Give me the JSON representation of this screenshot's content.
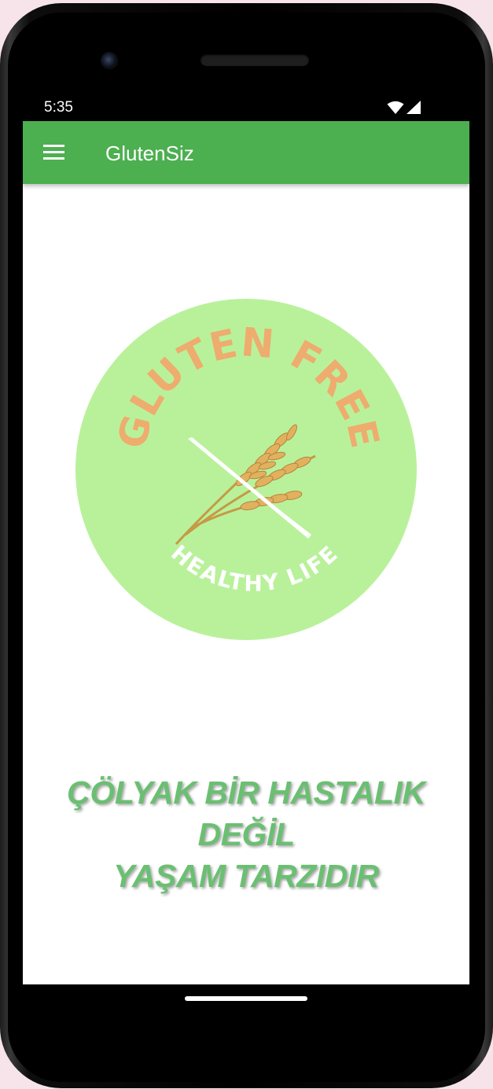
{
  "status_bar": {
    "time": "5:35",
    "icons": [
      "wifi-icon",
      "signal-icon"
    ]
  },
  "toolbar": {
    "title": "GlutenSiz",
    "menu_icon": "menu-icon",
    "color": "#4caf50"
  },
  "logo": {
    "top_text": "GLUTEN FREE",
    "bottom_text": "HEALTHY LIFE",
    "circle_color": "#b9f19b",
    "top_text_color": "#eeac6e"
  },
  "slogan": {
    "line1": "ÇÖLYAK BİR HASTALIK DEĞİL",
    "line2": "YAŞAM TARZIDIR",
    "color": "#6bbf72"
  }
}
